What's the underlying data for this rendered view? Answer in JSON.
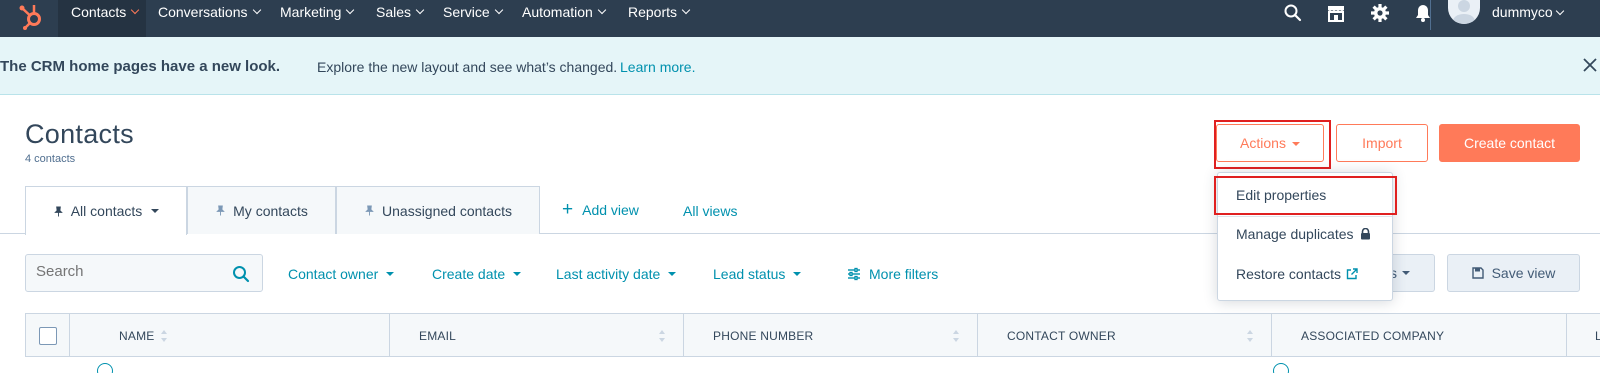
{
  "colors": {
    "nav_bg": "#2d3e50",
    "accent": "#ff7a59",
    "link": "#0091ae",
    "banner_bg": "#e5f5f8",
    "highlight_box": "#e02020"
  },
  "topnav": {
    "logo_icon": "hubspot-sprocket-icon",
    "items": [
      {
        "label": "Contacts",
        "active": true
      },
      {
        "label": "Conversations"
      },
      {
        "label": "Marketing"
      },
      {
        "label": "Sales"
      },
      {
        "label": "Service"
      },
      {
        "label": "Automation"
      },
      {
        "label": "Reports"
      }
    ],
    "icons": [
      "search-icon",
      "marketplace-icon",
      "settings-icon",
      "notifications-icon"
    ],
    "account_name": "dummyco"
  },
  "banner": {
    "title": "The CRM home pages have a new look.",
    "text": "Explore the new layout and see what’s changed.",
    "link": "Learn more."
  },
  "header": {
    "title": "Contacts",
    "record_count": "4 contacts",
    "actions_label": "Actions",
    "import_label": "Import",
    "create_label": "Create contact"
  },
  "actions_menu": {
    "items": [
      {
        "label": "Edit properties",
        "highlighted": true
      },
      {
        "label": "Manage duplicates",
        "icon": "lock-icon"
      },
      {
        "label": "Restore contacts",
        "icon": "external-link-icon"
      }
    ]
  },
  "tabs": {
    "views": [
      {
        "label": "All contacts",
        "active": true
      },
      {
        "label": "My contacts"
      },
      {
        "label": "Unassigned contacts"
      }
    ],
    "add_view": "Add view",
    "all_views": "All views"
  },
  "filters": {
    "search_placeholder": "Search",
    "items": [
      "Contact owner",
      "Create date",
      "Last activity date",
      "Lead status"
    ],
    "more_filters": "More filters",
    "partial_button_label": "s",
    "save_view": "Save view"
  },
  "table": {
    "columns": [
      "NAME",
      "EMAIL",
      "PHONE NUMBER",
      "CONTACT OWNER",
      "ASSOCIATED COMPANY",
      "L"
    ]
  }
}
